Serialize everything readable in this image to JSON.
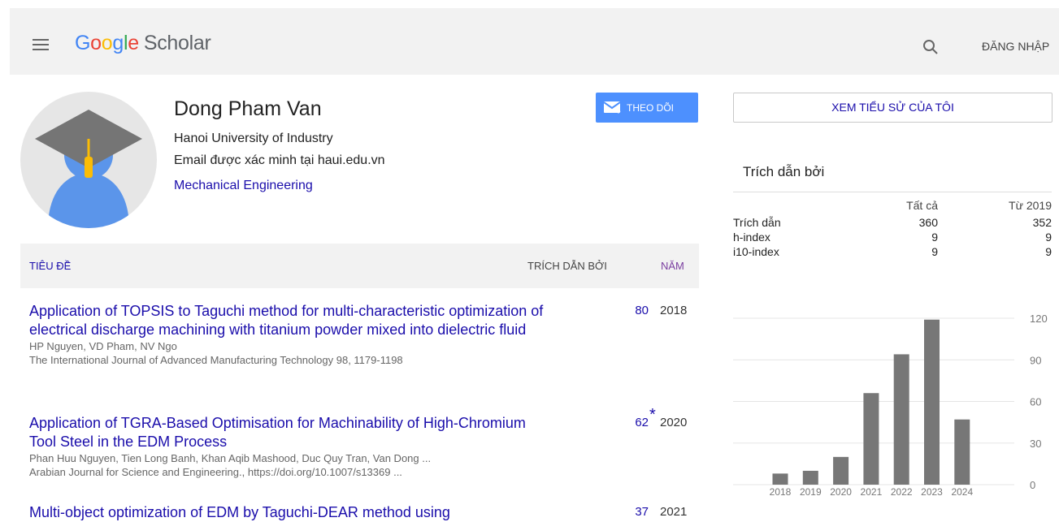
{
  "header": {
    "logo_google": [
      "G",
      "o",
      "o",
      "g",
      "l",
      "e"
    ],
    "logo_scholar": "Scholar",
    "signin_label": "ĐĂNG NHẬP"
  },
  "profile": {
    "name": "Dong Pham Van",
    "affiliation": "Hanoi University of Industry",
    "email": "Email được xác minh tại haui.edu.vn",
    "interest": "Mechanical Engineering",
    "follow_label": "THEO DÕI"
  },
  "table": {
    "col_title": "TIÊU ĐỀ",
    "col_cited": "TRÍCH DẪN BỞI",
    "col_year": "NĂM"
  },
  "articles": [
    {
      "title": "Application of TOPSIS to Taguchi method for multi-characteristic optimization of electrical discharge machining with titanium powder mixed into dielectric fluid",
      "authors": "HP Nguyen, VD Pham, NV Ngo",
      "venue": "The International Journal of Advanced Manufacturing Technology 98, 1179-1198",
      "cites": "80",
      "star": "",
      "year": "2018"
    },
    {
      "title": "Application of TGRA-Based Optimisation for Machinability of High-Chromium Tool Steel in the EDM Process",
      "authors": "Phan Huu Nguyen, Tien Long Banh, Khan Aqib Mashood, Duc Quy Tran, Van Dong ...",
      "venue": "Arabian Journal for Science and Engineering., https://doi.org/10.1007/s13369 ...",
      "cites": "62",
      "star": "*",
      "year": "2020"
    },
    {
      "title": "Multi-object optimization of EDM by Taguchi-DEAR method using",
      "authors": "",
      "venue": "",
      "cites": "37",
      "star": "",
      "year": "2021"
    }
  ],
  "sidebar": {
    "view_profile_label": "XEM TIỂU SỬ CỦA TÔI",
    "cited_by_heading": "Trích dẫn bởi",
    "col_all": "Tất cả",
    "col_since": "Từ 2019",
    "rows": [
      {
        "label": "Trích dẫn",
        "all": "360",
        "since": "352"
      },
      {
        "label": "h-index",
        "all": "9",
        "since": "9"
      },
      {
        "label": "i10-index",
        "all": "9",
        "since": "9"
      }
    ]
  },
  "chart_data": {
    "type": "bar",
    "categories": [
      "2018",
      "2019",
      "2020",
      "2021",
      "2022",
      "2023",
      "2024"
    ],
    "values": [
      8,
      10,
      20,
      66,
      94,
      119,
      47
    ],
    "ylim": [
      0,
      120
    ],
    "yticks": [
      "0",
      "30",
      "60",
      "90",
      "120"
    ],
    "bar_color": "#777777",
    "grid": true
  },
  "colors": {
    "link": "#1a0dab",
    "accent": "#4d90fe",
    "year_header": "#7b3fa0"
  }
}
